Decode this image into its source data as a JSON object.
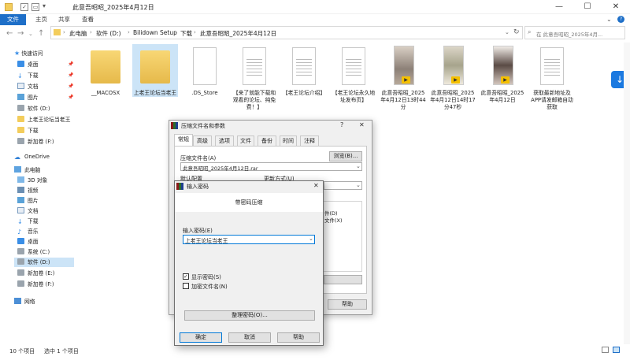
{
  "window": {
    "title": "此意吾昭昭_2025年4月12日",
    "minimize": "—",
    "maximize": "☐",
    "close": "✕"
  },
  "ribbon": {
    "tabs": [
      "文件",
      "主页",
      "共享",
      "查看"
    ]
  },
  "address": {
    "crumbs": [
      "此电脑",
      "软件 (D:)",
      "Bilidown Setup",
      "下载",
      "此意吾昭昭_2025年4月12日"
    ],
    "search_placeholder": "在 此意吾昭昭_2025年4月..."
  },
  "nav": {
    "quick_access": "快速访问",
    "quick_items": [
      "桌面",
      "下载",
      "文档",
      "图片",
      "软件 (D:)",
      "上老王论坛当老王",
      "下载",
      "新加卷 (F:)"
    ],
    "onedrive": "OneDrive",
    "this_pc": "此电脑",
    "pc_items": [
      "3D 对象",
      "视频",
      "图片",
      "文档",
      "下载",
      "音乐",
      "桌面",
      "系统 (C:)",
      "软件 (D:)",
      "新加卷 (E:)",
      "新加卷 (F:)"
    ],
    "network": "网络"
  },
  "files": [
    {
      "name": "__MACOSX",
      "kind": "folder"
    },
    {
      "name": "上老王论坛当老王",
      "kind": "folder"
    },
    {
      "name": ".DS_Store",
      "kind": "doc"
    },
    {
      "name": "【来了就能下载和观看的论坛、纯免费！】",
      "kind": "text"
    },
    {
      "name": "【老王论坛介绍】",
      "kind": "text"
    },
    {
      "name": "【老王论坛永久地址发布页】",
      "kind": "text"
    },
    {
      "name": "此意吾昭昭_2025年4月12日13时44分",
      "kind": "video"
    },
    {
      "name": "此意吾昭昭_2025年4月12日14时17分47秒",
      "kind": "video"
    },
    {
      "name": "此意吾昭昭_2025年4月12日",
      "kind": "video"
    },
    {
      "name": "获取最新地址及APP请发邮箱自动获取",
      "kind": "text"
    }
  ],
  "status": {
    "count": "10 个项目",
    "selected": "选中 1 个项目"
  },
  "archive_dialog": {
    "title": "压缩文件名和参数",
    "tabs": [
      "常规",
      "高级",
      "选项",
      "文件",
      "备份",
      "时间",
      "注释"
    ],
    "filename_label": "压缩文件名(A)",
    "filename_value": "此意吾昭昭_2025年4月12日.rar",
    "browse_button": "浏览(B)...",
    "profile_label": "默认配置",
    "update_label": "更新方式(U)",
    "opt_text_1": "件(D)",
    "opt_text_2": "文件(X)",
    "help_button": "帮助"
  },
  "password_dialog": {
    "title": "输入密码",
    "heading": "带密码压缩",
    "input_label": "输入密码(E)",
    "input_value": "上老王论坛当老王",
    "show_password": "显示密码(S)",
    "show_password_checked": true,
    "encrypt_names": "加密文件名(N)",
    "encrypt_names_checked": false,
    "organize_button": "整理密码(O)...",
    "ok_button": "确定",
    "cancel_button": "取消",
    "help_button": "帮助"
  }
}
